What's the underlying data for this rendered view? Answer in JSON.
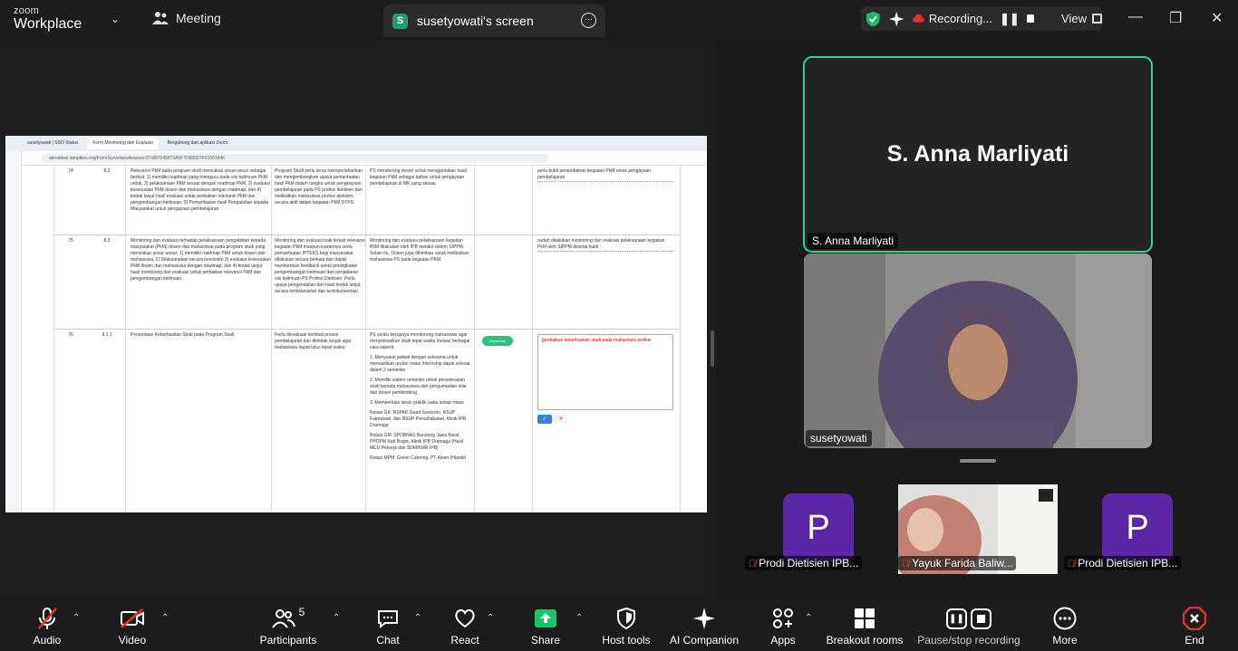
{
  "app": {
    "brand_top": "zoom",
    "brand_name": "Workplace"
  },
  "tabs": {
    "meeting": "Meeting",
    "screen_share": "susetyowati's screen",
    "screen_badge": "S"
  },
  "recording": {
    "label": "Recording...",
    "view": "View"
  },
  "shared_screen": {
    "browser_tabs": [
      "susetyowati | SSO Status",
      "Form Monitoring dan Evaluasi",
      "Bergabung dari aplikasi Zoom"
    ],
    "url": "akreditasi.lamptkes.org/FormSurveilansAssesor/37d9f7045ff73A5F7D60007F01001846",
    "rows": [
      {
        "no": "74",
        "code": "8.2",
        "c1": "Relevansi PkM pada program studi mencakup unsur-unsur sebagai berikut: 1) memiliki roadmap yang mengacu pada visi keilmuan PkM untuk, 2) pelaksanaan PkM sesuai dengan roadmap PkM, 3) evaluasi kesesuaian PkM dosen dan mahasiswa dengan roadmap, dan 4) tindak lanjut hasil evaluasi untuk perbaikan relevansi PkM dan pengembangan keilmuan. 5) Pemanfaatan hasil Pengabdian kepada Masyarakat untuk pengayaan pembelajaran.",
        "c2": "Program Studi perlu terus memperlahankan dan mengembangkan upaya pemanfaatan hasil PkM dalam rangka untuk pengkayaan pembelajaran pada PS profesi dietisien dan melibatkan mahasiswa profesi dietisien secara aktif dalam kegiatan PkM DTPS",
        "c3": "PS mendorong dosen untuk menggunakan hasil kegiatan PkM sebagai bahan untuk pengayaan pembelajaran di MK yang sesuai.",
        "c4": "perlu bukti penambahan kegiatan PkM untuk pengayaan pembelajaran"
      },
      {
        "no": "75",
        "code": "8.3",
        "c1": "Monitoring dan evaluasi terhadap pelaksanaan pengabdian kepada masyarakat (PkM) dosen dan mahasiswa pada program studi yang mencakup unsur-unsur: 1) memiliki roadmap PkM untuk dosen dan mahasiswa, 2) Dilaksanakan secara konsisten 3) evaluasi kesesuaian PkM dosen dan mahasiswa dengan roadmap, dan 4) tindak lanjut hasil monitoring dan evaluasi untuk perbaikan relevansi PkM dan pengembangan keilmuan.",
        "c2": "Monitoring dan evaluasi baik terkait relevansi kegiatan PkM maupun luarannya serta pemanfaatan IPTEKS bagi masyarakat dilakukan secara berkala dan dapat memberikan feedback untuk peningkatan pengembangan keilmuan dan penjabaran visi keilmuan PS Profesi Dietisien. Perlu upaya pengendalian dari hasil tindak lanjut secara berkelanjutan dan terdokumentasi",
        "c3": "Monitoring dan evaluasi pelaksanaan kegiatan PkM dilakukan oleh IPB melalui sistem SIPPM. Selain itu, Dosen juga dihimbau untuk melibatkan mahasiswa PS pada kegiatan PKM.",
        "c4": "sudah dilakukan monitoring dan evaluasi pelaksanaan kegiatan PkM oleh SIPPM disertai bukti"
      },
      {
        "no": "76",
        "code": "9.1.1",
        "c1": "Persentase Keberhasilan Studi pada Program Studi",
        "c2": "Perlu dievaluasi kembali proses pembelajaran dan ditindak lanjuti agar mahasiswa dapat lulus tepat waktu",
        "c3_paragraphs": [
          "PS selalu berupaya mendorong mahasiswa agar menyelesaikan studi tepat waktu melalui berbagai cara seperti:",
          "1. Menyusun jadwal dengan seksama untuk memastikan urutan rotasi Internship dapat selesai dalam 2 semester",
          "2. Memiliki sistem reminder untuk penyelesaian studi kepada mahasiswa dan pengumpulan nilai dari dosen pembimbing.",
          "3. Memperluas lahan praktik pada setiap rotasi",
          "Rotasi GK: RSPAD Gatot Soebroto, RSUP Fatmawati, dan RSUP Persahabatan, Klinik IPB Dramaga",
          "Rotasi GM: SPOBNAS Bandung Jawa Barat, PPOPM Kab Bogor, Klinik IPB Dramaga (Hasil MCU Pekerja dari SDM/KMR IPB)",
          "Rotasi MPM: Green Catering, PT Aloen (Handel"
        ],
        "download_label": "Download",
        "textarea_value": "[perbaikan keberhasilan studi pada mahasiswa profesi"
      }
    ]
  },
  "participants_panel": {
    "active_speaker": {
      "display_name": "S. Anna Marliyati",
      "label": "S. Anna Marliyati"
    },
    "video_tile": {
      "label": "susetyowati"
    },
    "thumbnails": [
      {
        "avatar_letter": "P",
        "label": "Prodi Dietisien IPB..."
      },
      {
        "label": "Yayuk Farida Baliw..."
      },
      {
        "avatar_letter": "P",
        "label": "Prodi Dietisien IPB..."
      }
    ]
  },
  "toolbar": {
    "audio": "Audio",
    "video": "Video",
    "participants": "Participants",
    "participants_count": "5",
    "chat": "Chat",
    "react": "React",
    "share": "Share",
    "host_tools": "Host tools",
    "ai_companion": "AI Companion",
    "apps": "Apps",
    "breakout_rooms": "Breakout rooms",
    "pause_stop_recording": "Pause/stop recording",
    "more": "More",
    "end": "End"
  },
  "colors": {
    "speaker_border": "#2fd38a",
    "share_green": "#19c36b",
    "end_red": "#e0322b",
    "avatar_purple": "#5b27a6"
  }
}
